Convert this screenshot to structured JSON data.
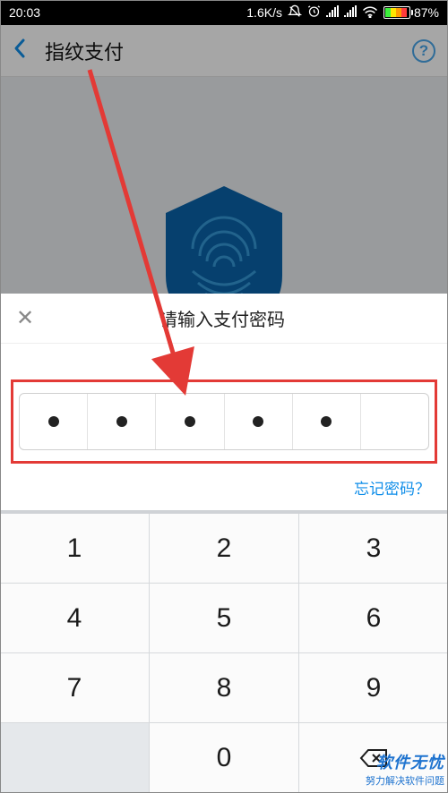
{
  "status": {
    "time": "20:03",
    "speed": "1.6K/s",
    "battery_pct": "87%"
  },
  "nav": {
    "title": "指纹支付",
    "help": "?"
  },
  "sheet": {
    "title": "请输入支付密码",
    "forgot": "忘记密码？",
    "filled_count": 5,
    "total_count": 6
  },
  "keypad": {
    "rows": [
      [
        "1",
        "2",
        "3"
      ],
      [
        "4",
        "5",
        "6"
      ],
      [
        "7",
        "8",
        "9"
      ],
      [
        "",
        "0",
        "⌫"
      ]
    ]
  },
  "watermark": {
    "line1": "软件无忧",
    "line2": "努力解决软件问题"
  }
}
